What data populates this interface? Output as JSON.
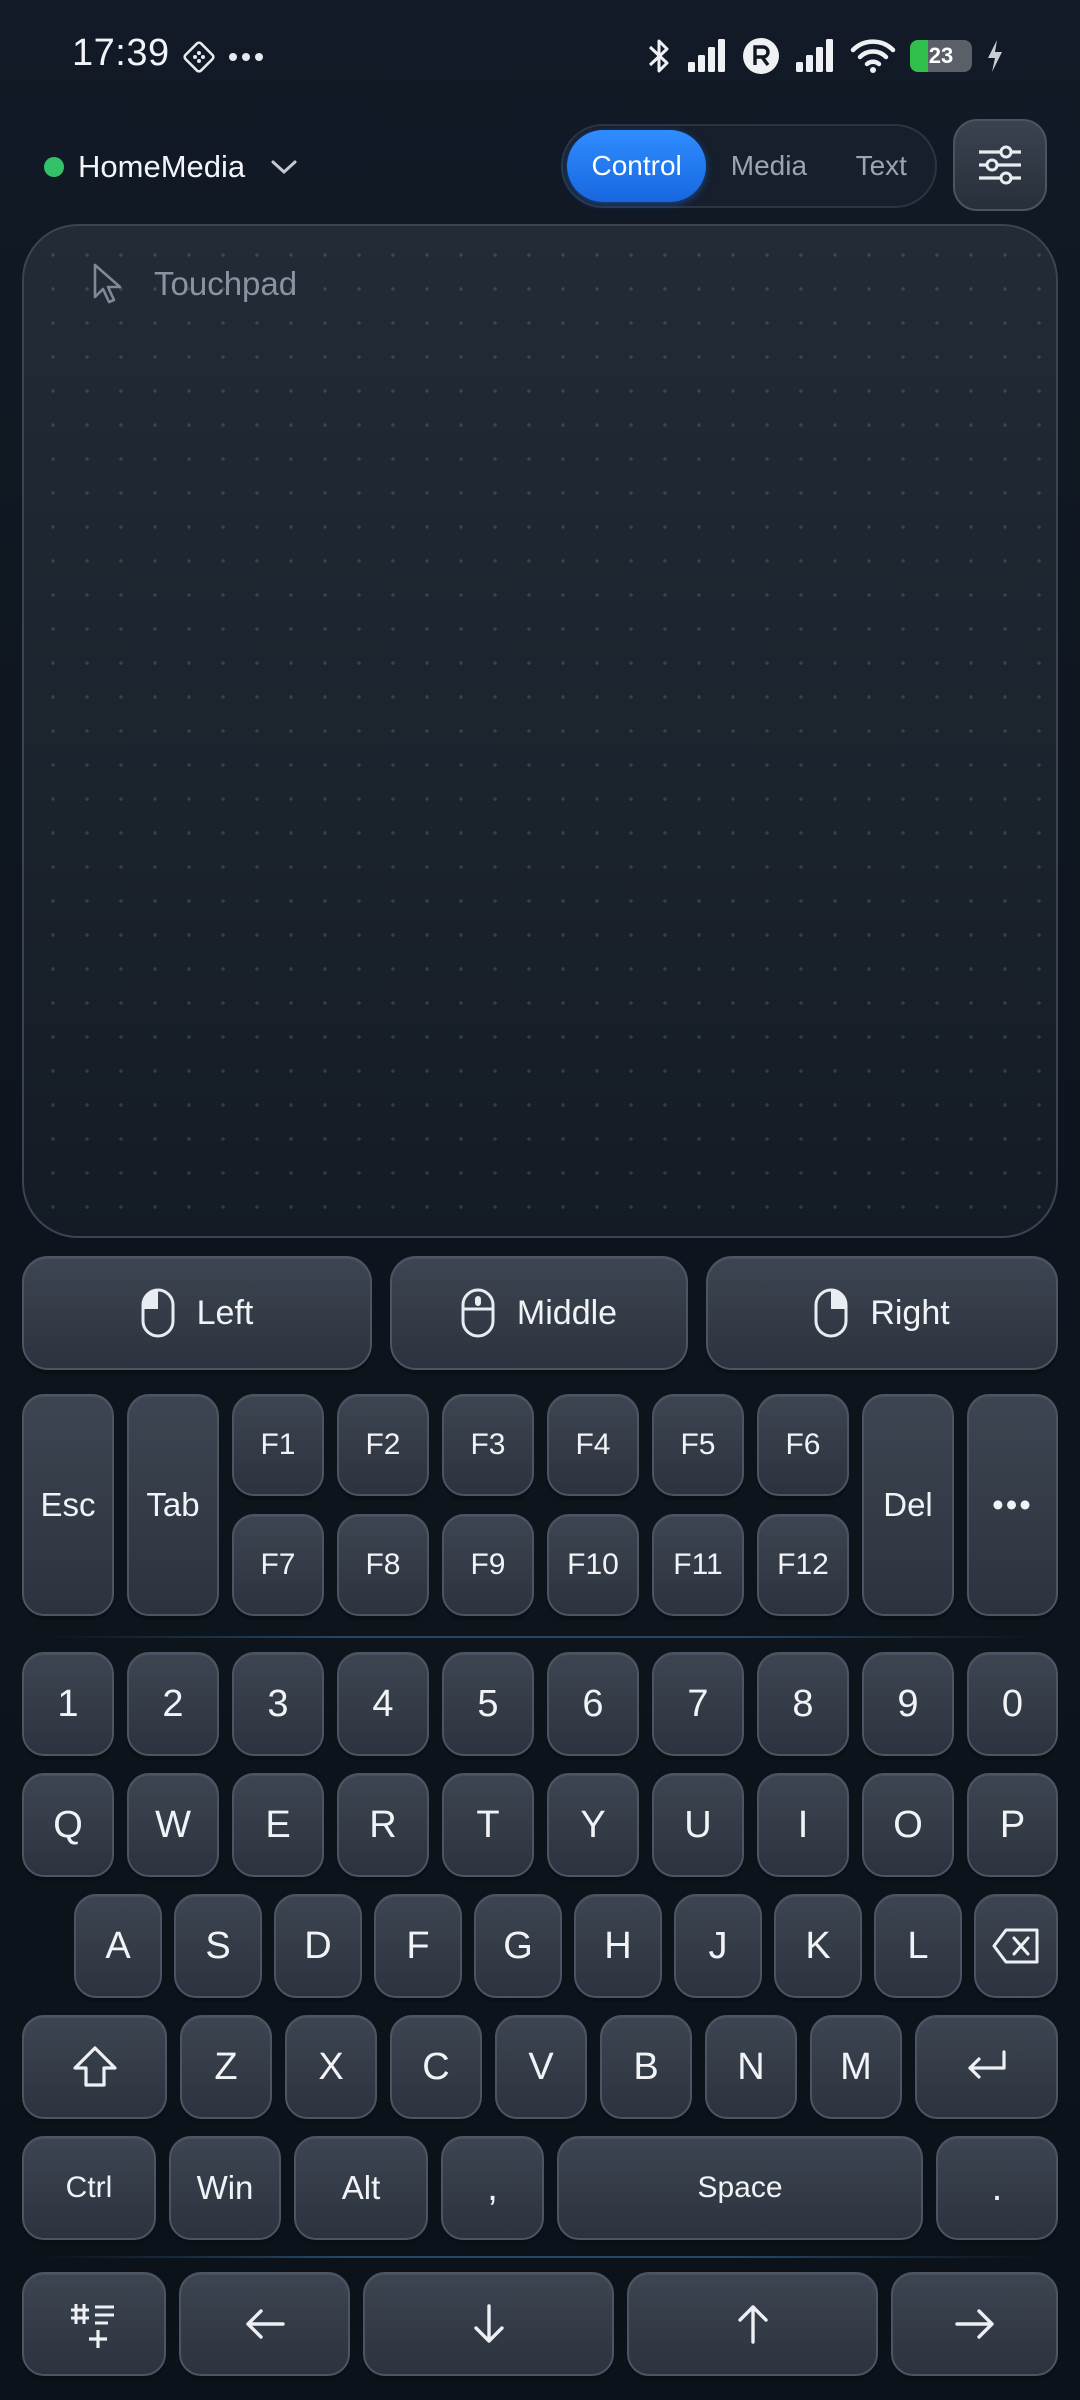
{
  "status_bar": {
    "time": "17:39",
    "battery": "23"
  },
  "header": {
    "device_name": "HomeMedia",
    "tabs": [
      {
        "label": "Control",
        "active": true
      },
      {
        "label": "Media",
        "active": false
      },
      {
        "label": "Text",
        "active": false
      }
    ]
  },
  "touchpad": {
    "label": "Touchpad"
  },
  "mouse": {
    "left": "Left",
    "middle": "Middle",
    "right": "Right"
  },
  "function_row": {
    "esc": "Esc",
    "tab": "Tab",
    "del": "Del",
    "more": "•••",
    "f_top": [
      "F1",
      "F2",
      "F3",
      "F4",
      "F5",
      "F6"
    ],
    "f_bottom": [
      "F7",
      "F8",
      "F9",
      "F10",
      "F11",
      "F12"
    ]
  },
  "keyboard": {
    "numbers": [
      "1",
      "2",
      "3",
      "4",
      "5",
      "6",
      "7",
      "8",
      "9",
      "0"
    ],
    "row1": [
      "Q",
      "W",
      "E",
      "R",
      "T",
      "Y",
      "U",
      "I",
      "O",
      "P"
    ],
    "row2": [
      "A",
      "S",
      "D",
      "F",
      "G",
      "H",
      "J",
      "K",
      "L"
    ],
    "row3": [
      "Z",
      "X",
      "C",
      "V",
      "B",
      "N",
      "M"
    ],
    "bottom": {
      "ctrl": "Ctrl",
      "win": "Win",
      "alt": "Alt",
      "comma": ",",
      "space": "Space",
      "period": "."
    }
  },
  "colors": {
    "accent": "#1e78ff",
    "online": "#33c26a",
    "background": "#0f1620"
  }
}
